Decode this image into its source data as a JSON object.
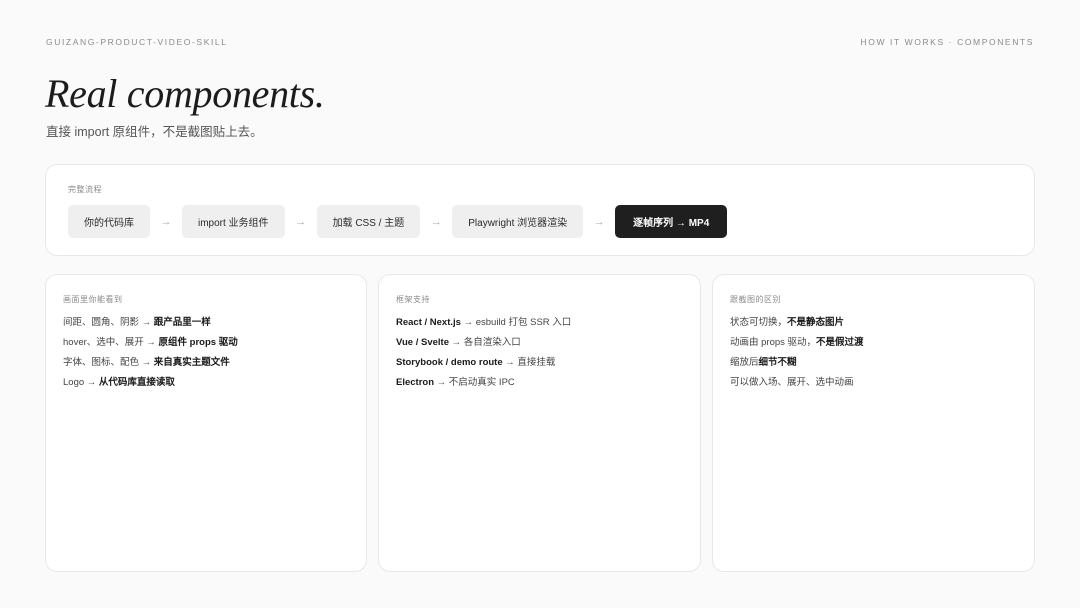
{
  "header": {
    "left": "GUIZANG-PRODUCT-VIDEO-SKILL",
    "right": "HOW IT WORKS · COMPONENTS"
  },
  "title": "Real components.",
  "subtitle": "直接 import 原组件，不是截图贴上去。",
  "flow": {
    "label": "完整流程",
    "steps": [
      "你的代码库",
      "import 业务组件",
      "加载 CSS / 主题",
      "Playwright 浏览器渲染",
      "逐帧序列 → MP4"
    ],
    "arrow": "→"
  },
  "cards": [
    {
      "label": "画面里你能看到",
      "lines": [
        {
          "a": "间距、圆角、阴影 → ",
          "b": "跟产品里一样"
        },
        {
          "a": "hover、选中、展开 → ",
          "b": "原组件 props 驱动"
        },
        {
          "a": "字体、图标、配色 → ",
          "b": "来自真实主题文件"
        },
        {
          "a": "Logo → ",
          "b": "从代码库直接读取"
        }
      ]
    },
    {
      "label": "框架支持",
      "lines": [
        {
          "b": "React / Next.js",
          "a": " → esbuild 打包 SSR 入口"
        },
        {
          "b": "Vue / Svelte",
          "a": " → 各自渲染入口"
        },
        {
          "b": "Storybook / demo route",
          "a": " → 直接挂载"
        },
        {
          "b": "Electron",
          "a": " → 不启动真实 IPC"
        }
      ]
    },
    {
      "label": "跟截图的区别",
      "lines": [
        {
          "a": "状态可切换，",
          "b": "不是静态图片"
        },
        {
          "a": "动画由 props 驱动，",
          "b": "不是假过渡"
        },
        {
          "a": "缩放后",
          "b": "细节不糊"
        },
        {
          "a": "可以做入场、展开、选中动画",
          "b": ""
        }
      ]
    }
  ]
}
